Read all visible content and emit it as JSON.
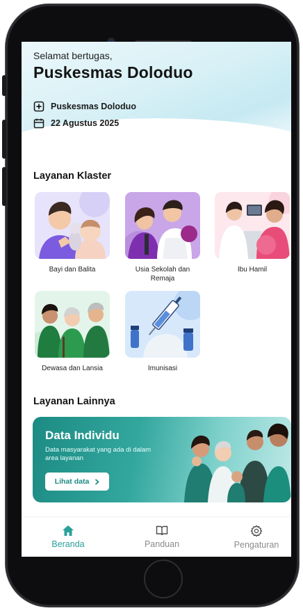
{
  "header": {
    "greeting": "Selamat bertugas,",
    "title": "Puskesmas Doloduo",
    "facility": "Puskesmas Doloduo",
    "date": "22 Agustus 2025"
  },
  "cluster_section": {
    "title": "Layanan Klaster",
    "items": [
      {
        "label": "Bayi dan Balita"
      },
      {
        "label": "Usia Sekolah dan Remaja"
      },
      {
        "label": "Ibu Hamil"
      },
      {
        "label": "Dewasa dan Lansia"
      },
      {
        "label": "Imunisasi"
      }
    ]
  },
  "other_section": {
    "title": "Layanan Lainnya",
    "banner": {
      "title": "Data Individu",
      "subtitle": "Data masyarakat yang ada di dalam area layanan",
      "button_label": "Lihat data",
      "button_icon": "chevron-right-icon"
    }
  },
  "bottom_nav": {
    "items": [
      {
        "label": "Beranda",
        "icon": "home-icon",
        "active": true
      },
      {
        "label": "Panduan",
        "icon": "book-icon",
        "active": false
      },
      {
        "label": "Pengaturan",
        "icon": "gear-icon",
        "active": false
      }
    ]
  },
  "colors": {
    "accent": "#2aa09a",
    "banner_start": "#1c8b83",
    "text_dark": "#161616"
  }
}
